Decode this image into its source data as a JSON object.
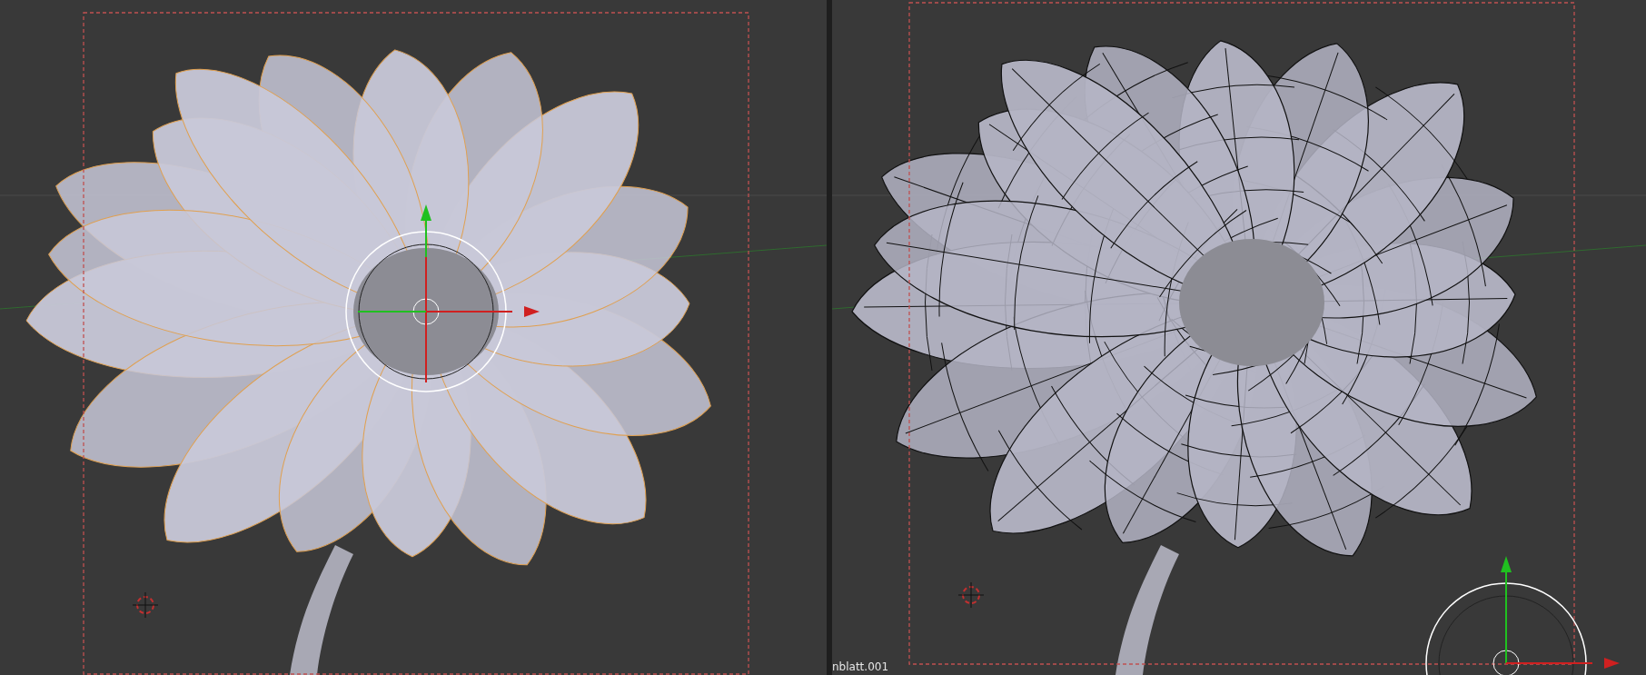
{
  "viewports": [
    {
      "kind": "solid"
    },
    {
      "kind": "wireframe",
      "object_label": "nblatt.001"
    }
  ]
}
